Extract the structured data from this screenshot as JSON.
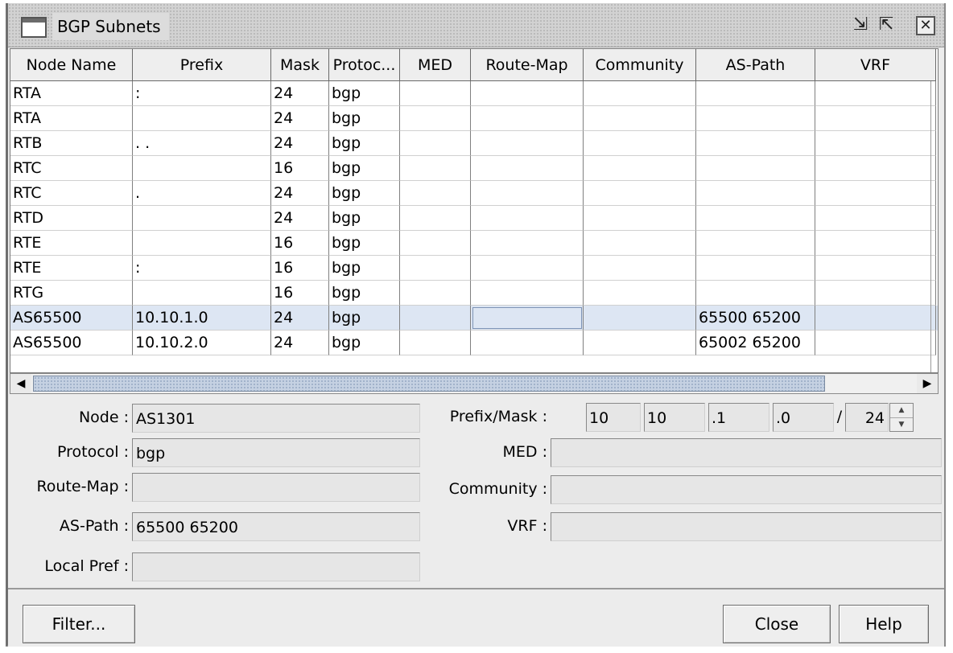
{
  "window": {
    "title": "BGP Subnets",
    "icons": {
      "minimize": "restore-down-icon",
      "maximize": "pop-out-icon",
      "close": "close-box-icon"
    },
    "close_glyph": "✕"
  },
  "table": {
    "columns": [
      "Node Name",
      "Prefix",
      "Mask",
      "Protoc...",
      "MED",
      "Route-Map",
      "Community",
      "AS-Path",
      "VRF"
    ],
    "rows": [
      {
        "node": "RTA",
        "prefix": ":",
        "mask": "24",
        "protocol": "bgp",
        "med": "",
        "route_map": "",
        "community": "",
        "as_path": "",
        "vrf": ""
      },
      {
        "node": "RTA",
        "prefix": "",
        "mask": "24",
        "protocol": "bgp",
        "med": "",
        "route_map": "",
        "community": "",
        "as_path": "",
        "vrf": ""
      },
      {
        "node": "RTB",
        "prefix": ".                 .",
        "mask": "24",
        "protocol": "bgp",
        "med": "",
        "route_map": "",
        "community": "",
        "as_path": "",
        "vrf": ""
      },
      {
        "node": "RTC",
        "prefix": "",
        "mask": "16",
        "protocol": "bgp",
        "med": "",
        "route_map": "",
        "community": "",
        "as_path": "",
        "vrf": ""
      },
      {
        "node": "RTC",
        "prefix": ".",
        "mask": "24",
        "protocol": "bgp",
        "med": "",
        "route_map": "",
        "community": "",
        "as_path": "",
        "vrf": ""
      },
      {
        "node": "RTD",
        "prefix": "",
        "mask": "24",
        "protocol": "bgp",
        "med": "",
        "route_map": "",
        "community": "",
        "as_path": "",
        "vrf": ""
      },
      {
        "node": "RTE",
        "prefix": "",
        "mask": "16",
        "protocol": "bgp",
        "med": "",
        "route_map": "",
        "community": "",
        "as_path": "",
        "vrf": ""
      },
      {
        "node": "RTE",
        "prefix": ":",
        "mask": "16",
        "protocol": "bgp",
        "med": "",
        "route_map": "",
        "community": "",
        "as_path": "",
        "vrf": ""
      },
      {
        "node": "RTG",
        "prefix": "",
        "mask": "16",
        "protocol": "bgp",
        "med": "",
        "route_map": "",
        "community": "",
        "as_path": "",
        "vrf": ""
      },
      {
        "node": "AS65500",
        "prefix": "10.10.1.0",
        "mask": "24",
        "protocol": "bgp",
        "med": "",
        "route_map": "",
        "community": "",
        "as_path": "65500 65200",
        "vrf": "",
        "selected": true
      },
      {
        "node": "AS65500",
        "prefix": "10.10.2.0",
        "mask": "24",
        "protocol": "bgp",
        "med": "",
        "route_map": "",
        "community": "",
        "as_path": "65002 65200",
        "vrf": ""
      }
    ]
  },
  "scrollbar": {
    "left_arrow": "◀",
    "right_arrow": "▶"
  },
  "detail": {
    "node_label": "Node :",
    "node_value": "AS1301",
    "protocol_label": "Protocol :",
    "protocol_value": "bgp",
    "route_map_label": "Route-Map :",
    "route_map_value": "",
    "as_path_label": "AS-Path :",
    "as_path_value": "65500 65200",
    "local_pref_label": "Local Pref :",
    "local_pref_value": "",
    "prefix_mask_label": "Prefix/Mask :",
    "prefix_octets": [
      "10",
      "10",
      ".1",
      ".0"
    ],
    "mask_value": "24",
    "mask_sep": "/",
    "spin_up": "▲",
    "spin_down": "▼",
    "med_label": "MED :",
    "med_value": "",
    "community_label": "Community :",
    "community_value": "",
    "vrf_label": "VRF :",
    "vrf_value": ""
  },
  "buttons": {
    "filter": "Filter...",
    "close": "Close",
    "help": "Help"
  }
}
